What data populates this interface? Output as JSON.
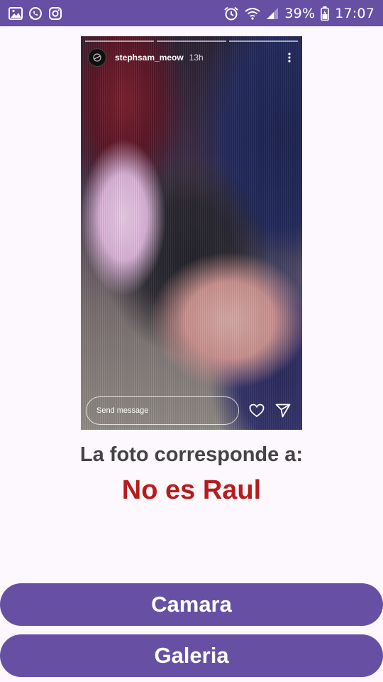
{
  "status_bar": {
    "background": "#6750a4",
    "left_icons": [
      "image-icon",
      "whatsapp-icon",
      "instagram-icon"
    ],
    "right_icons": [
      "alarm-icon",
      "wifi-icon",
      "signal-icon",
      "battery-icon"
    ],
    "battery_percent": "39%",
    "time": "17:07"
  },
  "story": {
    "username": "stephsam_meow",
    "time_ago": "13h",
    "message_placeholder": "Send message",
    "progress_segments": 3
  },
  "result": {
    "label": "La foto corresponde a:",
    "value": "No es Raul",
    "label_color": "#444444",
    "value_color": "#b71c1c"
  },
  "buttons": {
    "camera_label": "Camara",
    "gallery_label": "Galeria",
    "color": "#6750a4"
  }
}
